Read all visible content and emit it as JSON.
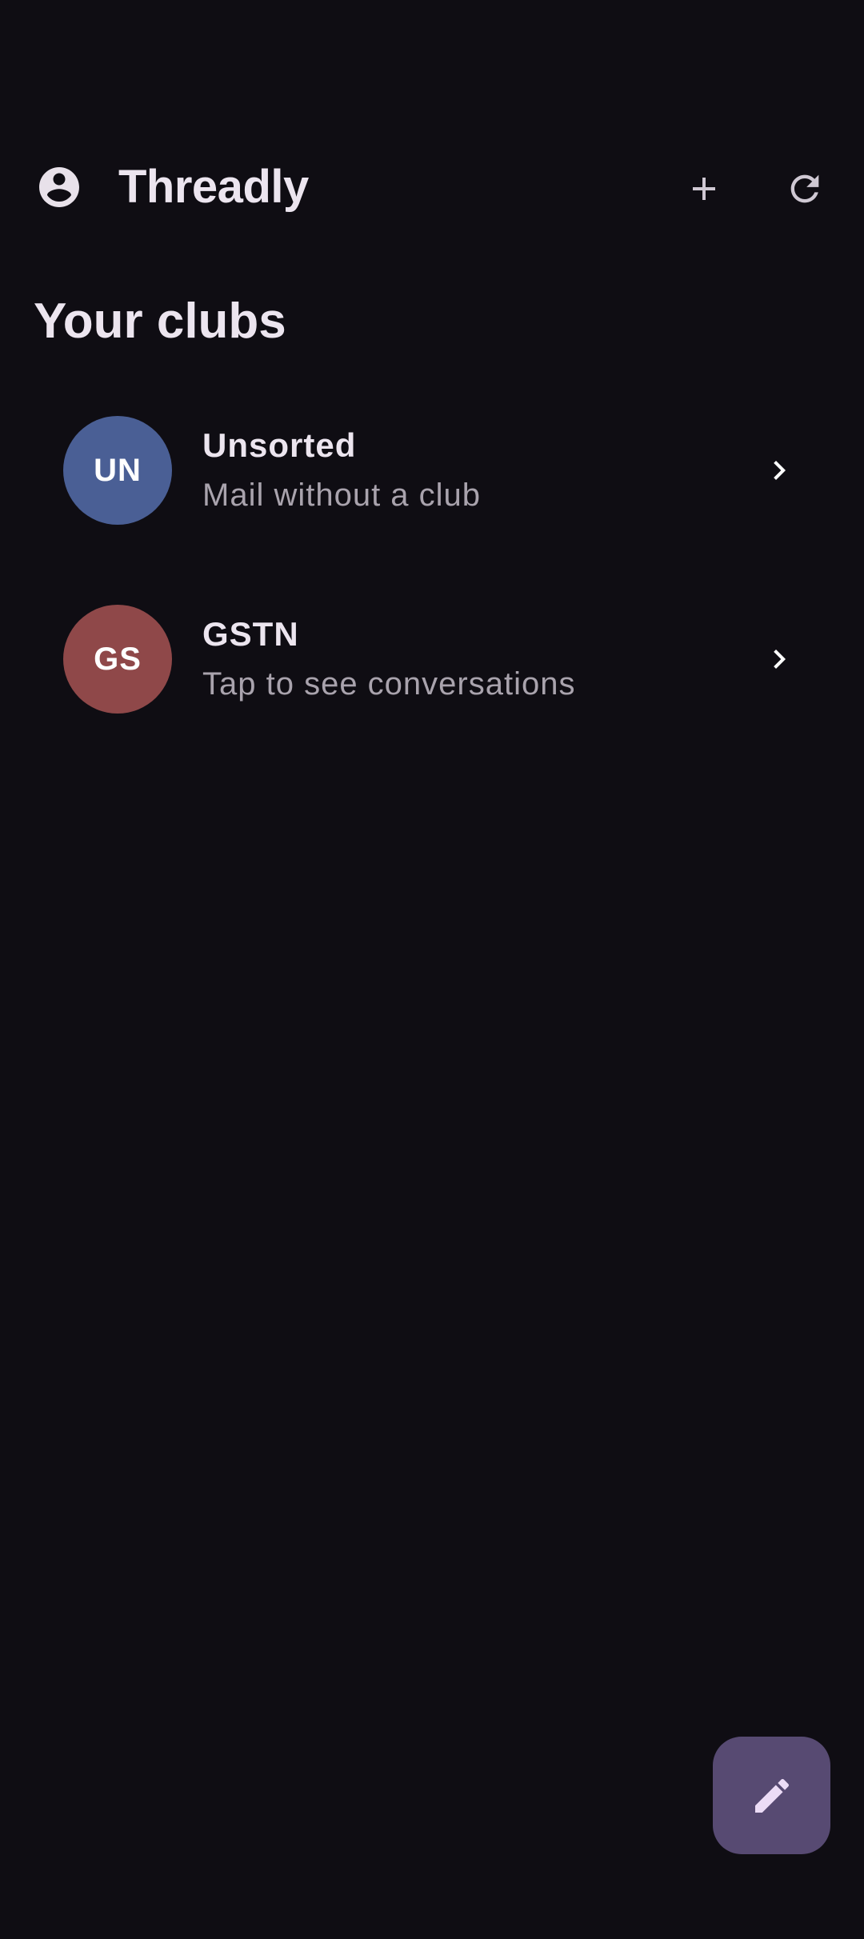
{
  "app": {
    "title": "Threadly",
    "account_icon": "account-circle-icon",
    "add_icon": "plus-icon",
    "refresh_icon": "refresh-icon"
  },
  "section": {
    "title": "Your clubs"
  },
  "clubs": [
    {
      "initials": "UN",
      "name": "Unsorted",
      "subtitle": "Mail without a club",
      "avatar_color": "#4a5f95"
    },
    {
      "initials": "GS",
      "name": "GSTN",
      "subtitle": "Tap to see conversations",
      "avatar_color": "#8f4849"
    }
  ],
  "fab": {
    "icon": "pencil-icon"
  },
  "colors": {
    "background": "#0f0d13",
    "fab": "#574a72",
    "text_primary": "#ece5ef",
    "text_secondary": "#a9a3ad"
  }
}
